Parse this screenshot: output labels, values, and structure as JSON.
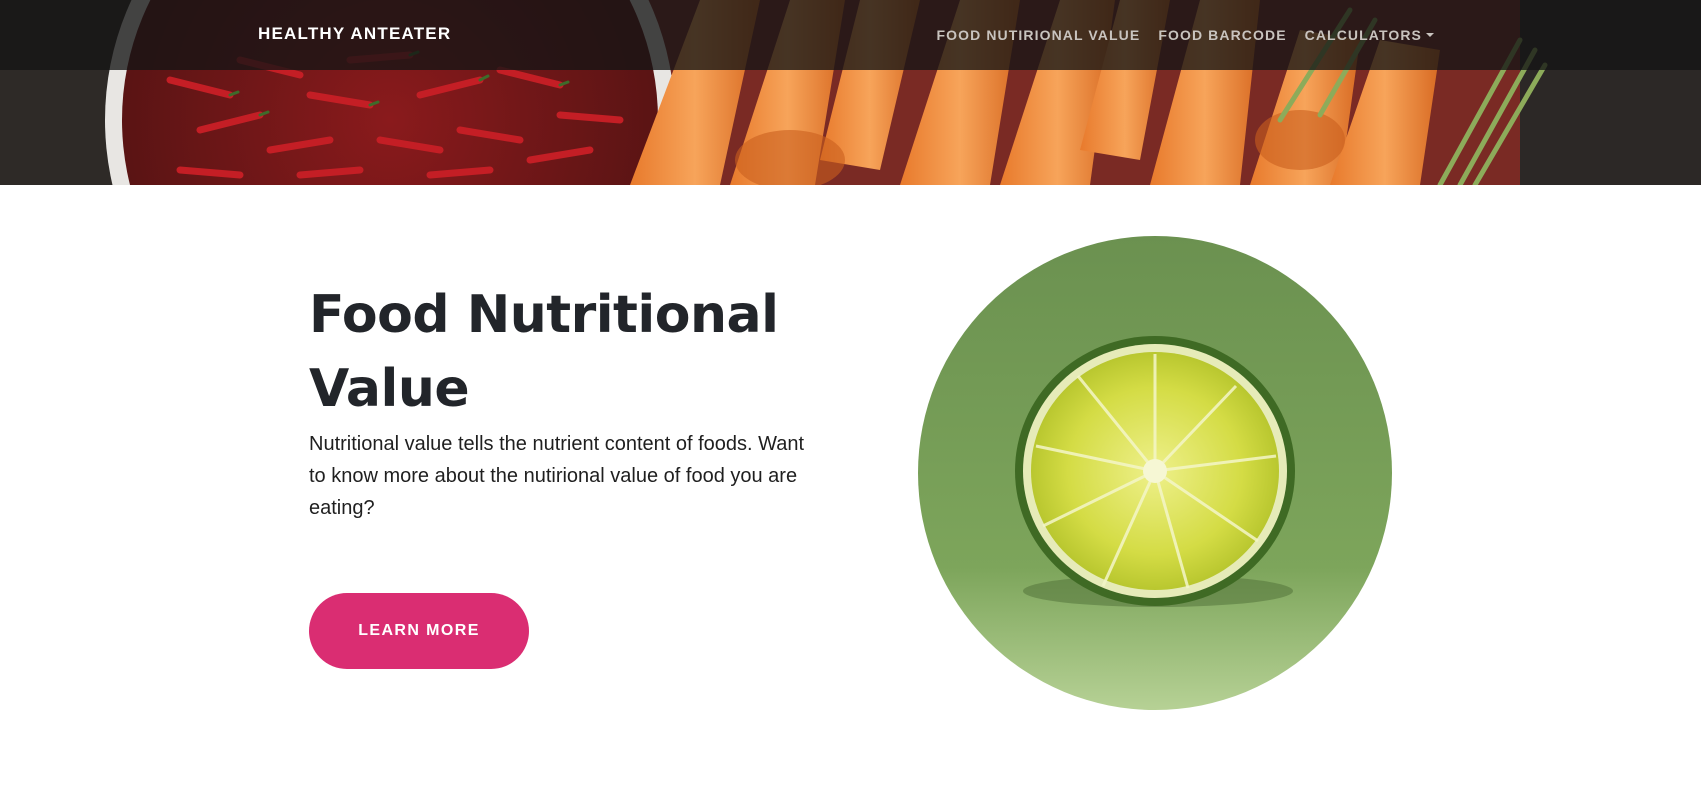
{
  "navbar": {
    "brand": "HEALTHY ANTEATER",
    "links": [
      {
        "label": "FOOD NUTIRIONAL VALUE"
      },
      {
        "label": "FOOD BARCODE"
      },
      {
        "label": "CALCULATORS",
        "dropdown": true
      }
    ]
  },
  "hero": {
    "image": "chili-peppers-and-carrots-banner"
  },
  "content": {
    "title": "Food Nutritional Value",
    "description": "Nutritional value tells the nutrient content of foods. Want to know more about the nutirional value of food you are eating?",
    "button_label": "LEARN MORE",
    "image": "sliced-lime-on-green-background"
  },
  "colors": {
    "accent": "#da2d72",
    "title": "#22252a",
    "navbar_bg": "#141414",
    "lime_background": "#6e9450"
  }
}
